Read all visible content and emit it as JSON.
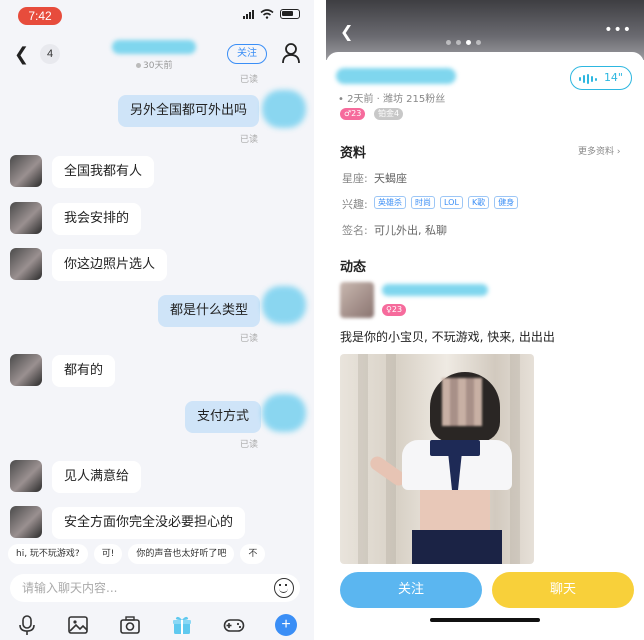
{
  "status_bar": {
    "time": "7:42"
  },
  "chat": {
    "unread_count": "4",
    "last_seen": "30天前",
    "follow_label": "关注",
    "messages": [
      {
        "side": "out",
        "text": "另外全国都可外出吗",
        "read": "已读"
      },
      {
        "side": "in",
        "text": "全国我都有人"
      },
      {
        "side": "in",
        "text": "我会安排的"
      },
      {
        "side": "in",
        "text": "你这边照片选人"
      },
      {
        "side": "out",
        "text": "都是什么类型",
        "read": "已读"
      },
      {
        "side": "in",
        "text": "都有的"
      },
      {
        "side": "out",
        "text": "支付方式",
        "read": "已读"
      },
      {
        "side": "in",
        "text": "见人满意给"
      },
      {
        "side": "in",
        "text": "安全方面你完全没必要担心的"
      }
    ],
    "top_read": "已读",
    "quick_replies": [
      "hi, 玩不玩游戏?",
      "可!",
      "你的声音也太好听了吧",
      "不"
    ],
    "input_placeholder": "请输入聊天内容...",
    "toolbar_icons": [
      "mic-icon",
      "image-icon",
      "camera-icon",
      "gift-icon",
      "gamepad-icon",
      "plus-icon"
    ]
  },
  "profile": {
    "voice_duration": "14\"",
    "meta": "• 2天前 · 潍坊   215粉丝",
    "badge_age": "♂23",
    "badge_level": "铂金4",
    "info_title": "资料",
    "more_info": "更多资料 ›",
    "constellation_label": "星座:",
    "constellation_value": "天蝎座",
    "interests_label": "兴趣:",
    "interests": [
      "英雄杀",
      "时尚",
      "LOL",
      "K歌",
      "健身"
    ],
    "signature_label": "签名:",
    "signature_value": "可儿外出, 私聊",
    "feed_title": "动态",
    "feed_badge": "♀23",
    "post_text": "我是你的小宝贝, 不玩游戏, 快来, 出出出",
    "follow_button": "关注",
    "chat_button": "聊天"
  }
}
